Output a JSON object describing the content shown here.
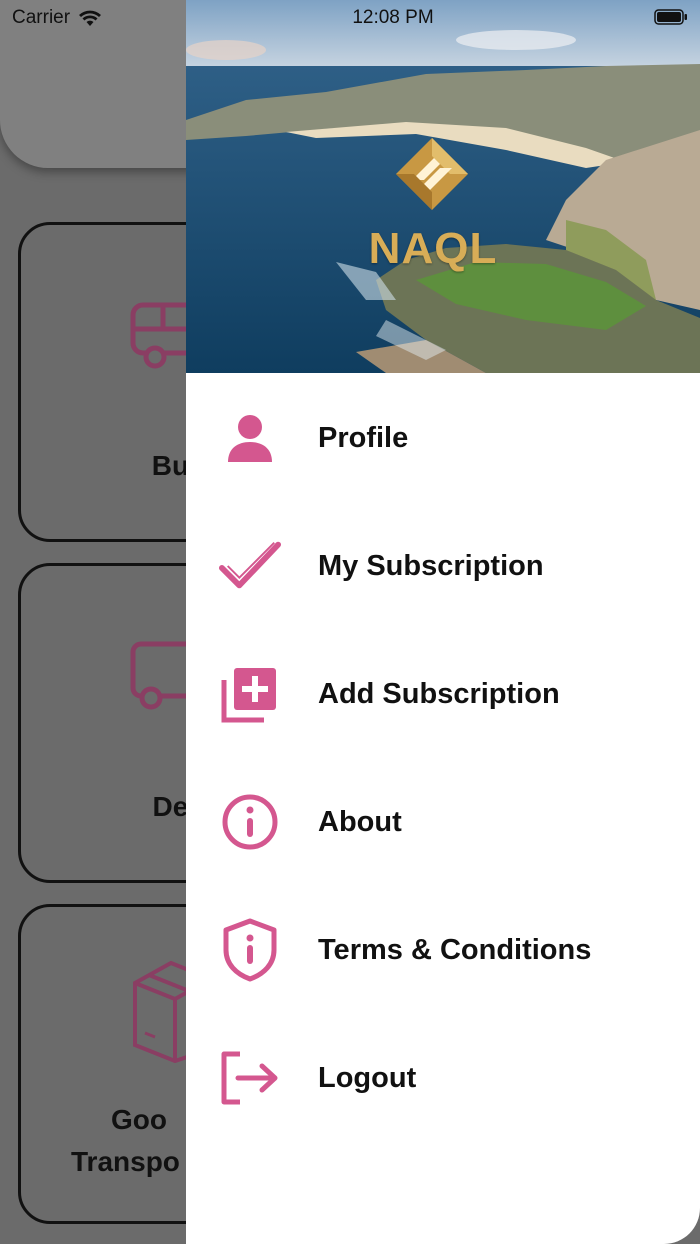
{
  "status_bar": {
    "carrier": "Carrier",
    "time": "12:08 PM"
  },
  "background_cards": [
    {
      "label": "Buss"
    },
    {
      "label": "Deliv"
    },
    {
      "label_line1": "Goo",
      "label_line2": "Transpo"
    }
  ],
  "drawer": {
    "logo_text": "NAQL",
    "menu": [
      {
        "label": "Profile",
        "icon": "person-icon"
      },
      {
        "label": "My Subscription",
        "icon": "checkmark-icon"
      },
      {
        "label": "Add Subscription",
        "icon": "add-stack-icon"
      },
      {
        "label": "About",
        "icon": "info-circle-icon"
      },
      {
        "label": "Terms & Conditions",
        "icon": "shield-info-icon"
      },
      {
        "label": "Logout",
        "icon": "logout-icon"
      }
    ]
  },
  "colors": {
    "accent": "#d4578f",
    "logo_gold": "#d8ad57",
    "overlay": "#6b6b6b"
  }
}
